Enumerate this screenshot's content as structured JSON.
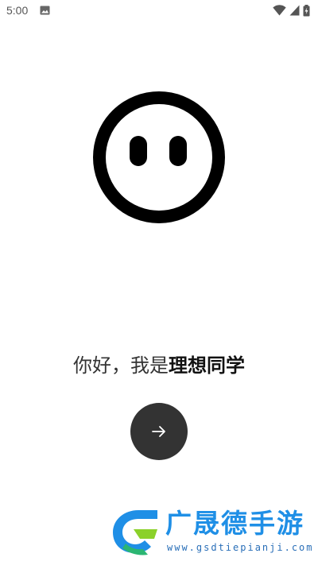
{
  "status_bar": {
    "time": "5:00",
    "icons": [
      "image-notification-icon",
      "wifi-icon",
      "cellular-signal-icon",
      "battery-charging-icon"
    ]
  },
  "mascot": {
    "icon": "smiley-face-icon",
    "color": "#000000"
  },
  "greeting": {
    "prefix": "你好，我是",
    "brand_name": "理想同学"
  },
  "next_button": {
    "icon": "arrow-right-icon",
    "background": "#333333"
  },
  "watermark": {
    "title": "广晟德手游",
    "url": "www.gsdtiepianji.com",
    "accent": "#1f8fe6"
  }
}
